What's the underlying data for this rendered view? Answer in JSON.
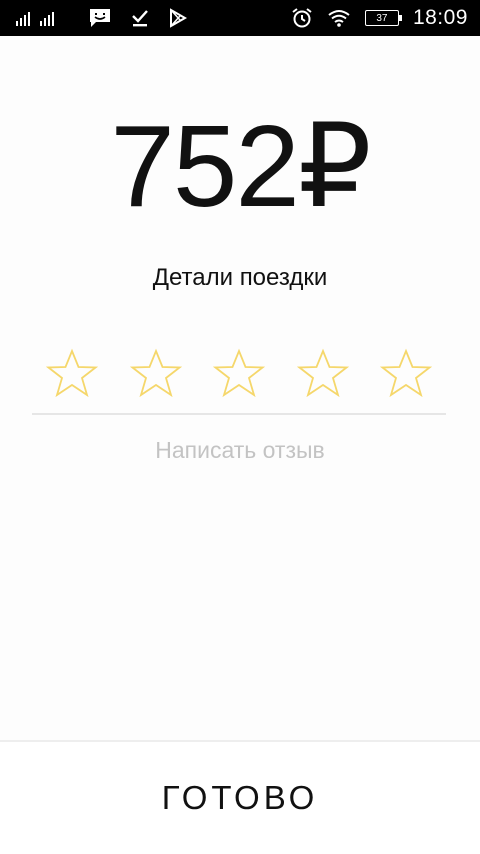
{
  "status_bar": {
    "time": "18:09",
    "battery_level": "37",
    "sim_indicator": "2",
    "icons": [
      "signal-icon",
      "message-icon",
      "download-done-icon",
      "play-store-icon",
      "alarm-icon",
      "wifi-icon",
      "battery-icon"
    ]
  },
  "trip": {
    "price": "752₽",
    "details_label": "Детали поездки"
  },
  "rating": {
    "max_stars": 5,
    "selected": 0,
    "star_color": "#f5d76b"
  },
  "review": {
    "placeholder": "Написать отзыв"
  },
  "footer": {
    "done_label": "ГОТОВО"
  }
}
